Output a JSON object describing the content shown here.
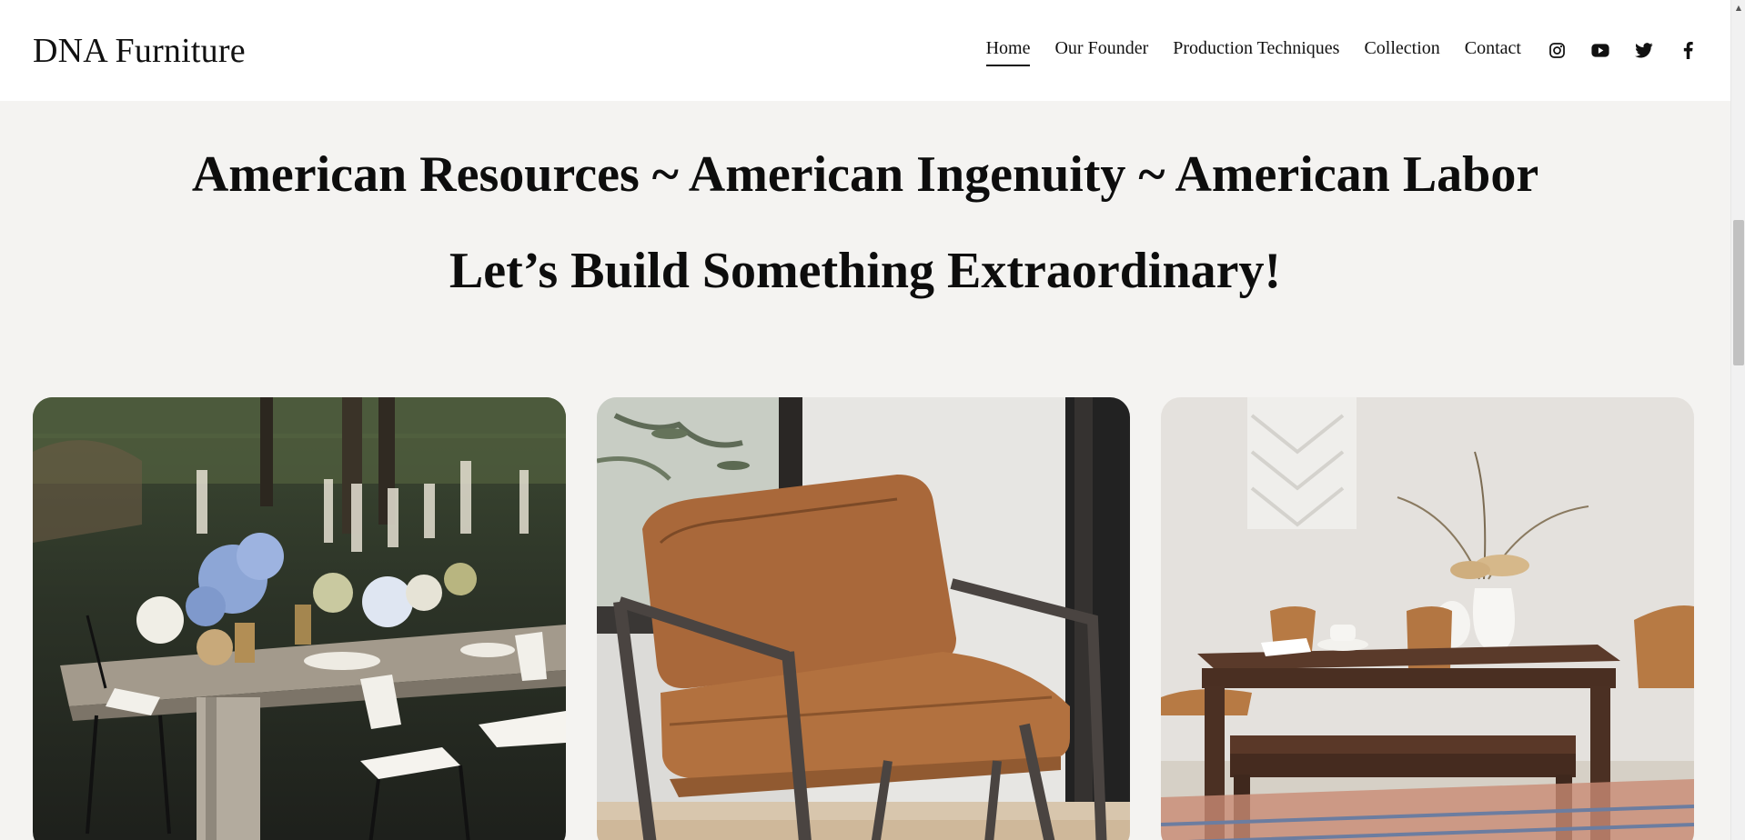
{
  "header": {
    "brand": "DNA Furniture",
    "nav": [
      {
        "label": "Home",
        "active": true
      },
      {
        "label": "Our Founder",
        "active": false
      },
      {
        "label": "Production Techniques",
        "active": false
      },
      {
        "label": "Collection",
        "active": false
      },
      {
        "label": "Contact",
        "active": false
      }
    ],
    "social_icons": [
      "instagram-icon",
      "youtube-icon",
      "twitter-icon",
      "facebook-icon"
    ]
  },
  "hero": {
    "line1": "American Resources ~ American Ingenuity ~ American Labor",
    "line2": "Let’s Build Something Extraordinary!"
  },
  "cards": [
    {
      "image": "outdoor-dining-table-photo"
    },
    {
      "image": "leather-lounge-chair-photo"
    },
    {
      "image": "dining-set-photo"
    }
  ],
  "colors": {
    "background": "#f4f3f1",
    "header_bg": "#ffffff",
    "text": "#111111"
  }
}
